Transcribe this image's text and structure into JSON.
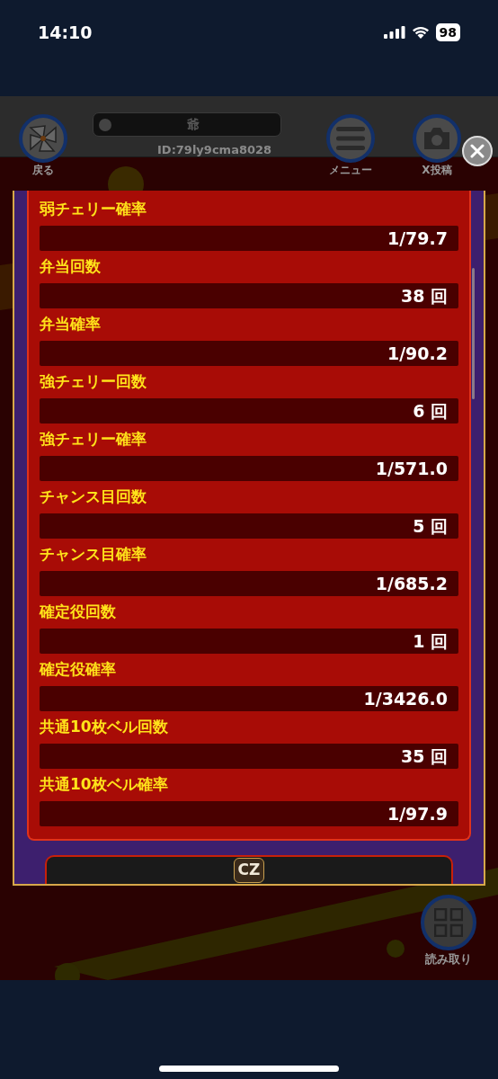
{
  "status_bar": {
    "time": "14:10",
    "battery": "98"
  },
  "header": {
    "back_label": "戻る",
    "player_name": "爺",
    "player_id": "ID:79ly9cma8028",
    "menu_label": "メニュー",
    "post_label": "X投稿"
  },
  "dialog": {
    "stats": [
      {
        "label": "弱チェリー確率",
        "value": "1/79.7"
      },
      {
        "label": "弁当回数",
        "value": "38 回"
      },
      {
        "label": "弁当確率",
        "value": "1/90.2"
      },
      {
        "label": "強チェリー回数",
        "value": "6 回"
      },
      {
        "label": "強チェリー確率",
        "value": "1/571.0"
      },
      {
        "label": "チャンス目回数",
        "value": "5 回"
      },
      {
        "label": "チャンス目確率",
        "value": "1/685.2"
      },
      {
        "label": "確定役回数",
        "value": "1 回"
      },
      {
        "label": "確定役確率",
        "value": "1/3426.0"
      },
      {
        "label": "共通10枚ベル回数",
        "value": "35 回"
      },
      {
        "label": "共通10枚ベル確率",
        "value": "1/97.9"
      }
    ],
    "tab": "CZ"
  },
  "qr_button": {
    "label": "読み取り"
  }
}
